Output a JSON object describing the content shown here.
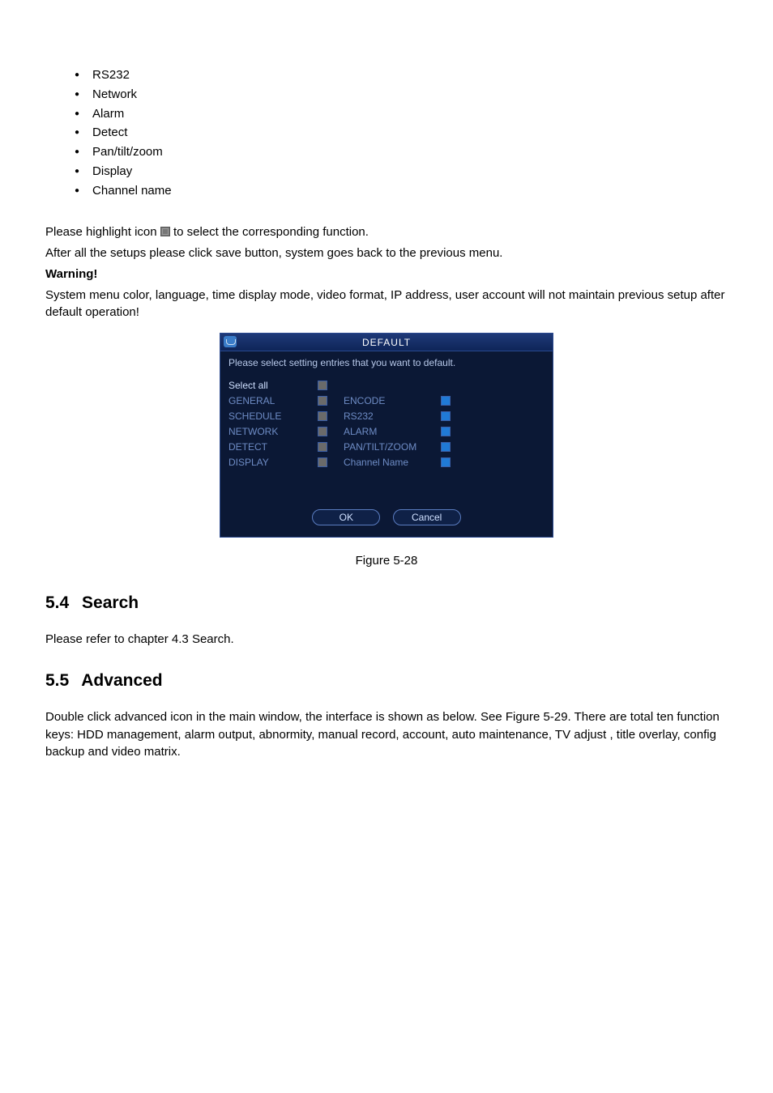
{
  "bullets": {
    "b0": "RS232",
    "b1": "Network",
    "b2": "Alarm",
    "b3": "Detect",
    "b4": "Pan/tilt/zoom",
    "b5": "Display",
    "b6": "Channel name"
  },
  "text": {
    "p1a": "Please highlight icon ",
    "p1b": " to select the corresponding function.",
    "p2": "After all the setups please click save button, system goes back to the previous menu.",
    "warn": "Warning!",
    "p3": "System menu color, language, time display mode, video format, IP address, user account will not maintain previous setup after default operation!"
  },
  "dialog": {
    "title": "DEFAULT",
    "instruction": "Please select setting entries that you want to default.",
    "left": {
      "r0": "Select all",
      "r1": "GENERAL",
      "r2": "SCHEDULE",
      "r3": "NETWORK",
      "r4": "DETECT",
      "r5": "DISPLAY"
    },
    "right": {
      "r0": "ENCODE",
      "r1": "RS232",
      "r2": "ALARM",
      "r3": "PAN/TILT/ZOOM",
      "r4": "Channel Name"
    },
    "ok": "OK",
    "cancel": "Cancel"
  },
  "figcap": "Figure 5-28",
  "sections": {
    "s4num": "5.4",
    "s4title": "Search",
    "s4body": "Please refer to chapter 4.3 Search.",
    "s5num": "5.5",
    "s5title": "Advanced",
    "s5body": "Double click advanced icon in the main window, the interface is shown as below. See Figure 5-29. There are total ten function keys: HDD management, alarm output, abnormity, manual record, account, auto maintenance, TV adjust ,  title overlay, config backup and video matrix."
  }
}
